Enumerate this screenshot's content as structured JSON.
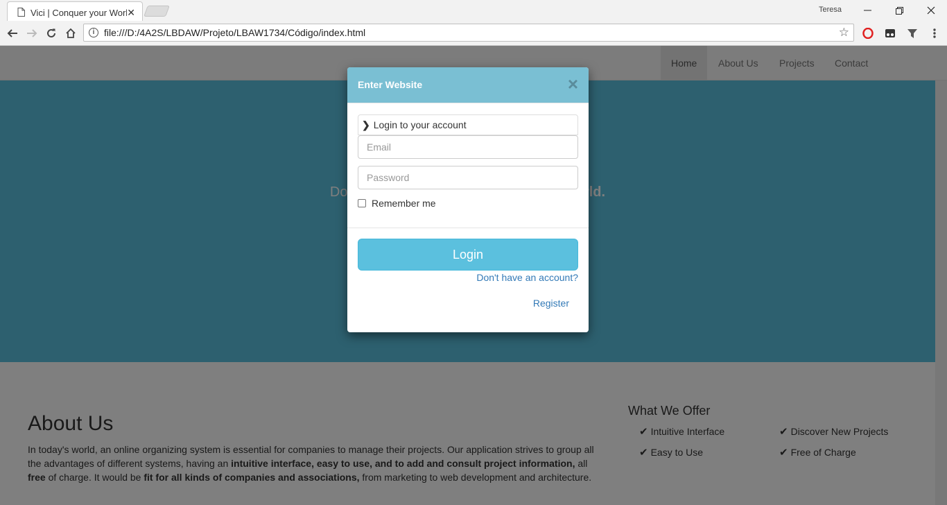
{
  "browser": {
    "tab_title": "Vici | Conquer your World",
    "user": "Teresa",
    "url": "file:///D:/4A2S/LBDAW/Projeto/LBAW1734/Código/index.html"
  },
  "navbar": {
    "items": [
      "Home",
      "About Us",
      "Projects",
      "Contact"
    ],
    "active": "Home"
  },
  "hero": {
    "lead_left": "Don't let ",
    "lead_right": "ur world."
  },
  "about": {
    "title": "About Us",
    "p1": "In today's world, an online organizing system is essential for companies to manage their projects. Our application strives to group all the advantages of different systems, having an ",
    "b1": "intuitive interface, easy to use, and to add and consult project information,",
    "p2": " all ",
    "b2": "free",
    "p3": " of charge. It would be ",
    "b3": "fit for all kinds of companies and associations,",
    "p4": " from marketing to web development and architecture."
  },
  "offer": {
    "title": "What We Offer",
    "items": [
      "Intuitive Interface",
      "Discover New Projects",
      "Easy to Use",
      "Free of Charge"
    ]
  },
  "modal": {
    "title": "Enter Website",
    "close": "×",
    "panel_heading": "Login to your account",
    "email_placeholder": "Email",
    "password_placeholder": "Password",
    "remember_label": "Remember me",
    "login_button": "Login",
    "no_account": "Don't have an account?",
    "register": "Register"
  }
}
